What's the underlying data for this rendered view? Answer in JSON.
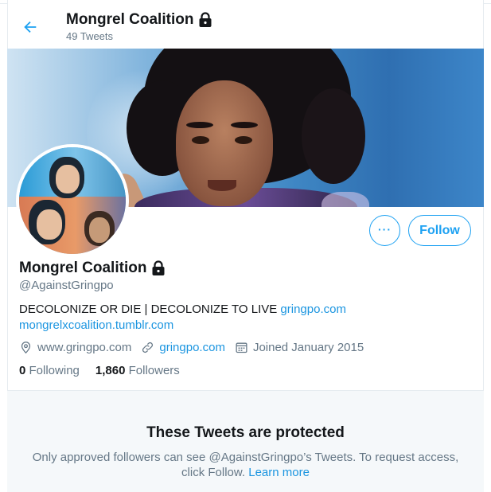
{
  "header": {
    "title": "Mongrel Coalition",
    "tweet_count": "49 Tweets"
  },
  "profile": {
    "name": "Mongrel Coalition",
    "handle": "@AgainstGringpo",
    "bio_text": "DECOLONIZE OR DIE | DECOLONIZE TO LIVE ",
    "bio_link1": "gringpo.com",
    "bio_link2": "mongrelxcoalition.tumblr.com",
    "location": "www.gringpo.com",
    "website": "gringpo.com",
    "joined": "Joined January 2015",
    "following_count": "0",
    "following_label": "Following",
    "followers_count": "1,860",
    "followers_label": "Followers"
  },
  "actions": {
    "follow_label": "Follow",
    "more_label": "···"
  },
  "protected": {
    "title": "These Tweets are protected",
    "text": "Only approved followers can see @AgainstGringpo’s Tweets. To request access, click Follow. ",
    "learn_more": "Learn more"
  },
  "icons": {
    "back": "back-arrow-icon",
    "lock": "lock-icon",
    "location": "location-pin-icon",
    "link": "link-icon",
    "calendar": "calendar-icon"
  },
  "colors": {
    "accent": "#1da1f2",
    "link": "#1b95e0",
    "secondary_text": "#657786"
  }
}
